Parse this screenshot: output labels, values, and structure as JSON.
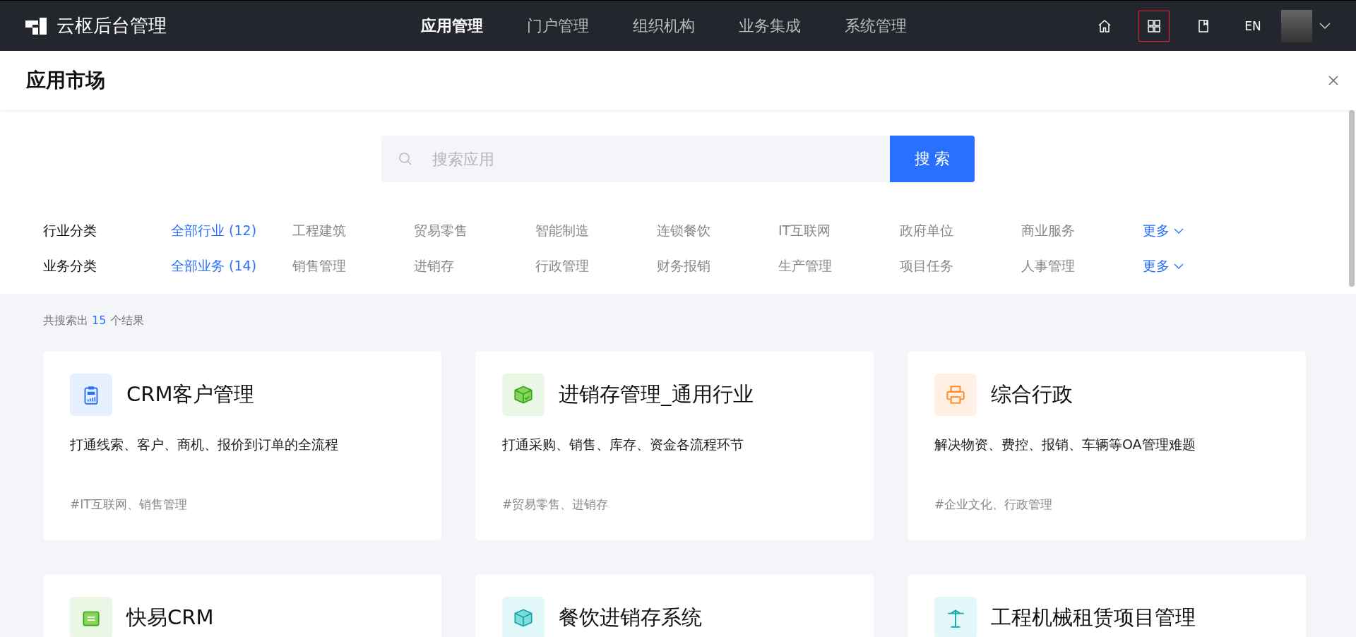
{
  "app_title": "云枢后台管理",
  "nav": [
    {
      "label": "应用管理",
      "selected": true
    },
    {
      "label": "门户管理",
      "selected": false
    },
    {
      "label": "组织机构",
      "selected": false
    },
    {
      "label": "业务集成",
      "selected": false
    },
    {
      "label": "系统管理",
      "selected": false
    }
  ],
  "toolbar": [
    {
      "kind": "home",
      "highlighted": false
    },
    {
      "kind": "grid",
      "highlighted": true
    },
    {
      "kind": "book",
      "highlighted": false
    },
    {
      "kind": "language",
      "label": "EN",
      "highlighted": false
    }
  ],
  "page_title": "应用市场",
  "search": {
    "placeholder": "搜索应用",
    "button": "搜 索"
  },
  "filters": [
    {
      "label": "行业分类",
      "options": [
        {
          "label": "全部行业 (12)",
          "selected": true
        },
        {
          "label": "工程建筑",
          "selected": false
        },
        {
          "label": "贸易零售",
          "selected": false
        },
        {
          "label": "智能制造",
          "selected": false
        },
        {
          "label": "连锁餐饮",
          "selected": false
        },
        {
          "label": "IT互联网",
          "selected": false
        },
        {
          "label": "政府单位",
          "selected": false
        },
        {
          "label": "商业服务",
          "selected": false
        }
      ],
      "more": "更多"
    },
    {
      "label": "业务分类",
      "options": [
        {
          "label": "全部业务 (14)",
          "selected": true
        },
        {
          "label": "销售管理",
          "selected": false
        },
        {
          "label": "进销存",
          "selected": false
        },
        {
          "label": "行政管理",
          "selected": false
        },
        {
          "label": "财务报销",
          "selected": false
        },
        {
          "label": "生产管理",
          "selected": false
        },
        {
          "label": "项目任务",
          "selected": false
        },
        {
          "label": "人事管理",
          "selected": false
        }
      ],
      "more": "更多"
    }
  ],
  "result_count": "共搜索出 **15** 个结果",
  "apps": [
    {
      "kind": "crm",
      "color": "#e6f0ff",
      "title": "CRM客户管理",
      "description": "打通线索、客户、商机、报价到订单的全流程",
      "tags": "#IT互联网、销售管理"
    },
    {
      "kind": "box",
      "color": "#eaf7e4",
      "title": "进销存管理_通用行业",
      "description": "打通采购、销售、库存、资金各流程环节",
      "tags": "#贸易零售、进销存"
    },
    {
      "kind": "printer",
      "color": "#fff0e3",
      "title": "综合行政",
      "description": "解决物资、费控、报销、车辆等OA管理难题",
      "tags": "#企业文化、行政管理"
    },
    {
      "kind": "tray",
      "color": "#eaf7e4",
      "title": "快易CRM"
    },
    {
      "kind": "cube",
      "color": "#e2f7f7",
      "title": "餐饮进销存系统"
    },
    {
      "kind": "crane",
      "color": "#e2f7f7",
      "title": "工程机械租赁项目管理"
    }
  ]
}
